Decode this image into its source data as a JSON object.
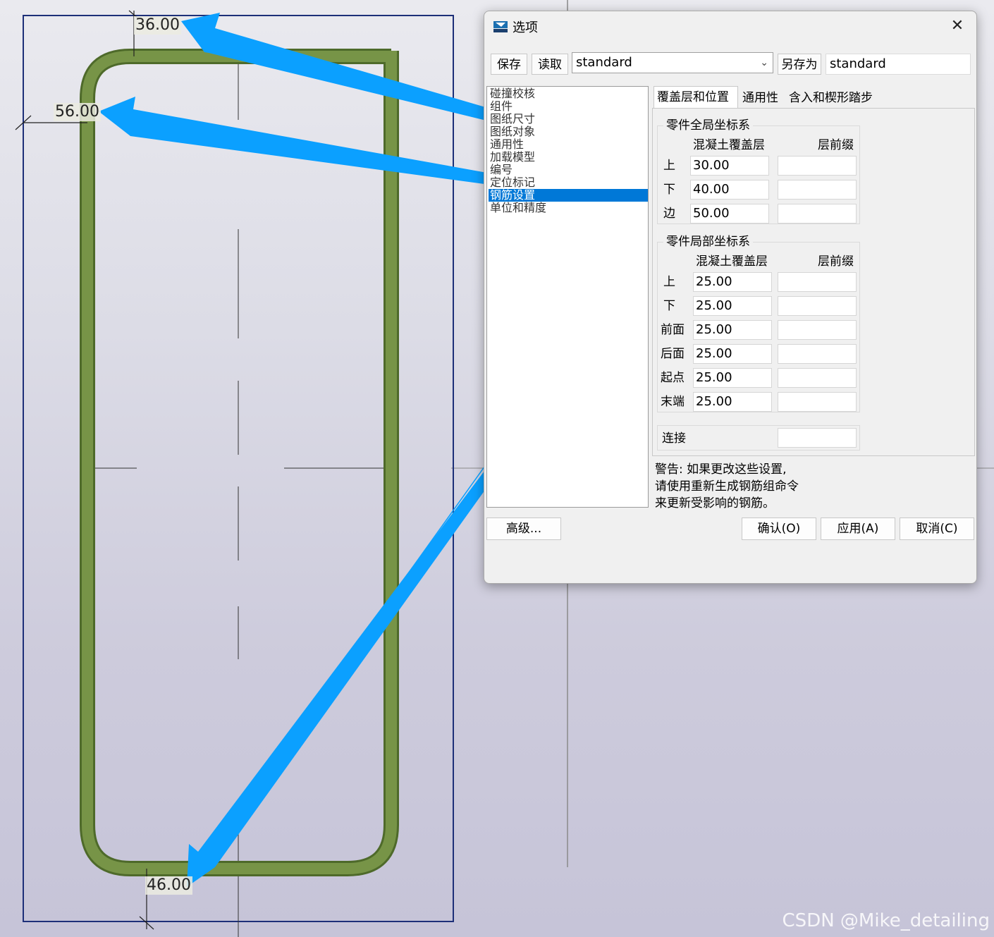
{
  "drawing": {
    "dims": {
      "top": "36.00",
      "left": "56.00",
      "bottom": "46.00"
    },
    "watermark": "CSDN @Mike_detailing",
    "colors": {
      "rebar": "#779447",
      "arrow": "#0ba0ff",
      "frame": "#1d2f78"
    }
  },
  "dialog": {
    "title": "选项",
    "icon": "app-logo-icon",
    "toolbar": {
      "save_label": "保存",
      "load_label": "读取",
      "preset_value": "standard",
      "save_as_label": "另存为",
      "save_as_value": "standard"
    },
    "categories": [
      "碰撞校核",
      "组件",
      "图纸尺寸",
      "图纸对象",
      "通用性",
      "加载模型",
      "编号",
      "定位标记",
      "钢筋设置",
      "单位和精度"
    ],
    "selected_category": "钢筋设置",
    "tabs": [
      "覆盖层和位置",
      "通用性",
      "含入和楔形踏步"
    ],
    "global": {
      "title": "零件全局坐标系",
      "col_cover": "混凝土覆盖层",
      "col_prefix": "层前缀",
      "rows": [
        {
          "label": "上",
          "cover": "30.00",
          "prefix": ""
        },
        {
          "label": "下",
          "cover": "40.00",
          "prefix": ""
        },
        {
          "label": "边",
          "cover": "50.00",
          "prefix": ""
        }
      ]
    },
    "local": {
      "title": "零件局部坐标系",
      "col_cover": "混凝土覆盖层",
      "col_prefix": "层前缀",
      "rows": [
        {
          "label": "上",
          "cover": "25.00",
          "prefix": ""
        },
        {
          "label": "下",
          "cover": "25.00",
          "prefix": ""
        },
        {
          "label": "前面",
          "cover": "25.00",
          "prefix": ""
        },
        {
          "label": "后面",
          "cover": "25.00",
          "prefix": ""
        },
        {
          "label": "起点",
          "cover": "25.00",
          "prefix": ""
        },
        {
          "label": "末端",
          "cover": "25.00",
          "prefix": ""
        }
      ]
    },
    "connect": {
      "label": "连接",
      "value": ""
    },
    "warning": [
      "警告: 如果更改这些设置,",
      "请使用重新生成钢筋组命令",
      "来更新受影响的钢筋。"
    ],
    "buttons": {
      "advanced": "高级...",
      "ok": "确认(O)",
      "apply": "应用(A)",
      "cancel": "取消(C)"
    }
  }
}
